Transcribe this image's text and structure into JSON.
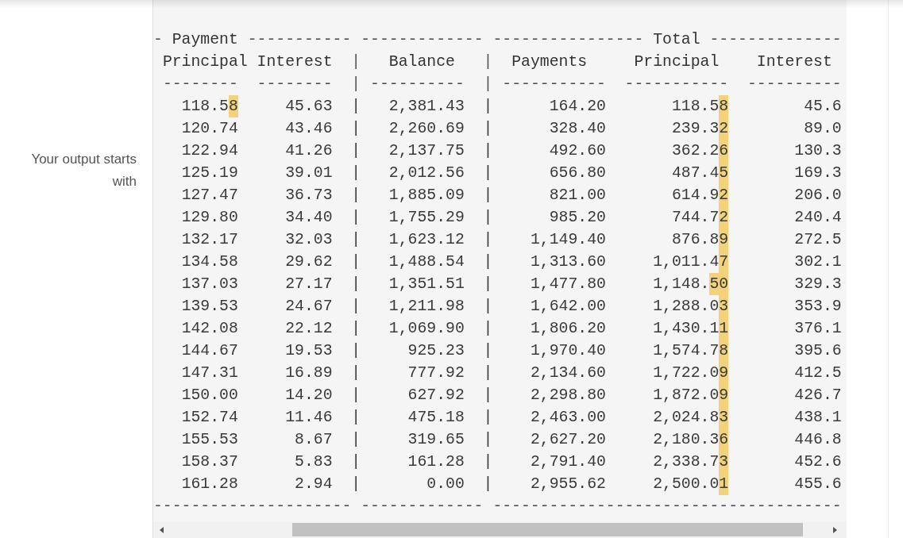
{
  "label": "Your output starts with",
  "group_header": [
    {
      "kind": "rule",
      "text": "-"
    },
    {
      "kind": "label",
      "text": "Payment"
    },
    {
      "kind": "rule",
      "text": "-----------"
    },
    {
      "kind": "rule",
      "text": "-------------"
    },
    {
      "kind": "rule",
      "text": "----------------"
    },
    {
      "kind": "label",
      "text": "Total"
    },
    {
      "kind": "rule",
      "text": "--------------"
    }
  ],
  "column_headers": [
    {
      "kind": "label",
      "text": "Principal"
    },
    {
      "kind": "label",
      "text": "Interest"
    },
    {
      "kind": "separator",
      "text": "|"
    },
    {
      "kind": "label",
      "text": "Balance"
    },
    {
      "kind": "separator",
      "text": "|"
    },
    {
      "kind": "label",
      "text": "Payments"
    },
    {
      "kind": "label",
      "text": "Principal"
    },
    {
      "kind": "label",
      "text": "Interest"
    }
  ],
  "header_rule": [
    {
      "kind": "rule",
      "text": "--------"
    },
    {
      "kind": "rule",
      "text": "--------"
    },
    {
      "kind": "separator",
      "text": "|"
    },
    {
      "kind": "rule",
      "text": "----------"
    },
    {
      "kind": "separator",
      "text": "|"
    },
    {
      "kind": "rule",
      "text": "-----------"
    },
    {
      "kind": "rule",
      "text": "-----------"
    },
    {
      "kind": "rule",
      "text": "----------"
    }
  ],
  "rows": [
    {
      "principal": {
        "plain": "118.5",
        "highlighted": "8"
      },
      "interest": "45.63",
      "sep_1": "|",
      "balance": "2,381.43",
      "sep_2": "|",
      "payments": "164.20",
      "total_principal": {
        "plain": "118.5",
        "highlighted": "8"
      },
      "total_interest": "45.6"
    },
    {
      "principal": "120.74",
      "interest": "43.46",
      "sep_1": "|",
      "balance": "2,260.69",
      "sep_2": "|",
      "payments": "328.40",
      "total_principal": {
        "plain": "239.3",
        "highlighted": "2"
      },
      "total_interest": "89.0"
    },
    {
      "principal": "122.94",
      "interest": "41.26",
      "sep_1": "|",
      "balance": "2,137.75",
      "sep_2": "|",
      "payments": "492.60",
      "total_principal": {
        "plain": "362.2",
        "highlighted": "6"
      },
      "total_interest": "130.3"
    },
    {
      "principal": "125.19",
      "interest": "39.01",
      "sep_1": "|",
      "balance": "2,012.56",
      "sep_2": "|",
      "payments": "656.80",
      "total_principal": {
        "plain": "487.4",
        "highlighted": "5"
      },
      "total_interest": "169.3"
    },
    {
      "principal": "127.47",
      "interest": "36.73",
      "sep_1": "|",
      "balance": "1,885.09",
      "sep_2": "|",
      "payments": "821.00",
      "total_principal": {
        "plain": "614.9",
        "highlighted": "2"
      },
      "total_interest": "206.0"
    },
    {
      "principal": "129.80",
      "interest": "34.40",
      "sep_1": "|",
      "balance": "1,755.29",
      "sep_2": "|",
      "payments": "985.20",
      "total_principal": {
        "plain": "744.7",
        "highlighted": "2"
      },
      "total_interest": "240.4"
    },
    {
      "principal": "132.17",
      "interest": "32.03",
      "sep_1": "|",
      "balance": "1,623.12",
      "sep_2": "|",
      "payments": "1,149.40",
      "total_principal": {
        "plain": "876.8",
        "highlighted": "9"
      },
      "total_interest": "272.5"
    },
    {
      "principal": "134.58",
      "interest": "29.62",
      "sep_1": "|",
      "balance": "1,488.54",
      "sep_2": "|",
      "payments": "1,313.60",
      "total_principal": {
        "plain": "1,011.4",
        "highlighted": "7"
      },
      "total_interest": "302.1"
    },
    {
      "principal": "137.03",
      "interest": "27.17",
      "sep_1": "|",
      "balance": "1,351.51",
      "sep_2": "|",
      "payments": "1,477.80",
      "total_principal": {
        "plain": "1,148.",
        "highlighted": "50"
      },
      "total_interest": "329.3"
    },
    {
      "principal": "139.53",
      "interest": "24.67",
      "sep_1": "|",
      "balance": "1,211.98",
      "sep_2": "|",
      "payments": "1,642.00",
      "total_principal": {
        "plain": "1,288.0",
        "highlighted": "3"
      },
      "total_interest": "353.9"
    },
    {
      "principal": "142.08",
      "interest": "22.12",
      "sep_1": "|",
      "balance": "1,069.90",
      "sep_2": "|",
      "payments": "1,806.20",
      "total_principal": {
        "plain": "1,430.1",
        "highlighted": "1"
      },
      "total_interest": "376.1"
    },
    {
      "principal": "144.67",
      "interest": "19.53",
      "sep_1": "|",
      "balance": "925.23",
      "sep_2": "|",
      "payments": "1,970.40",
      "total_principal": {
        "plain": "1,574.7",
        "highlighted": "8"
      },
      "total_interest": "395.6"
    },
    {
      "principal": "147.31",
      "interest": "16.89",
      "sep_1": "|",
      "balance": "777.92",
      "sep_2": "|",
      "payments": "2,134.60",
      "total_principal": {
        "plain": "1,722.0",
        "highlighted": "9"
      },
      "total_interest": "412.5"
    },
    {
      "principal": "150.00",
      "interest": "14.20",
      "sep_1": "|",
      "balance": "627.92",
      "sep_2": "|",
      "payments": "2,298.80",
      "total_principal": {
        "plain": "1,872.0",
        "highlighted": "9"
      },
      "total_interest": "426.7"
    },
    {
      "principal": "152.74",
      "interest": "11.46",
      "sep_1": "|",
      "balance": "475.18",
      "sep_2": "|",
      "payments": "2,463.00",
      "total_principal": {
        "plain": "2,024.8",
        "highlighted": "3"
      },
      "total_interest": "438.1"
    },
    {
      "principal": "155.53",
      "interest": "8.67",
      "sep_1": "|",
      "balance": "319.65",
      "sep_2": "|",
      "payments": "2,627.20",
      "total_principal": {
        "plain": "2,180.3",
        "highlighted": "6"
      },
      "total_interest": "446.8"
    },
    {
      "principal": "158.37",
      "interest": "5.83",
      "sep_1": "|",
      "balance": "161.28",
      "sep_2": "|",
      "payments": "2,791.40",
      "total_principal": {
        "plain": "2,338.7",
        "highlighted": "3"
      },
      "total_interest": "452.6"
    },
    {
      "principal": "161.28",
      "interest": "2.94",
      "sep_1": "|",
      "balance": "0.00",
      "sep_2": "|",
      "payments": "2,955.62",
      "total_principal": {
        "plain": "2,500.0",
        "highlighted": "1"
      },
      "total_interest": "455.6"
    }
  ],
  "footer_rule": [
    {
      "kind": "rule",
      "text": "---------------------"
    },
    {
      "kind": "rule",
      "text": "-------------"
    },
    {
      "kind": "rule",
      "text": "-------------------------------------"
    }
  ]
}
